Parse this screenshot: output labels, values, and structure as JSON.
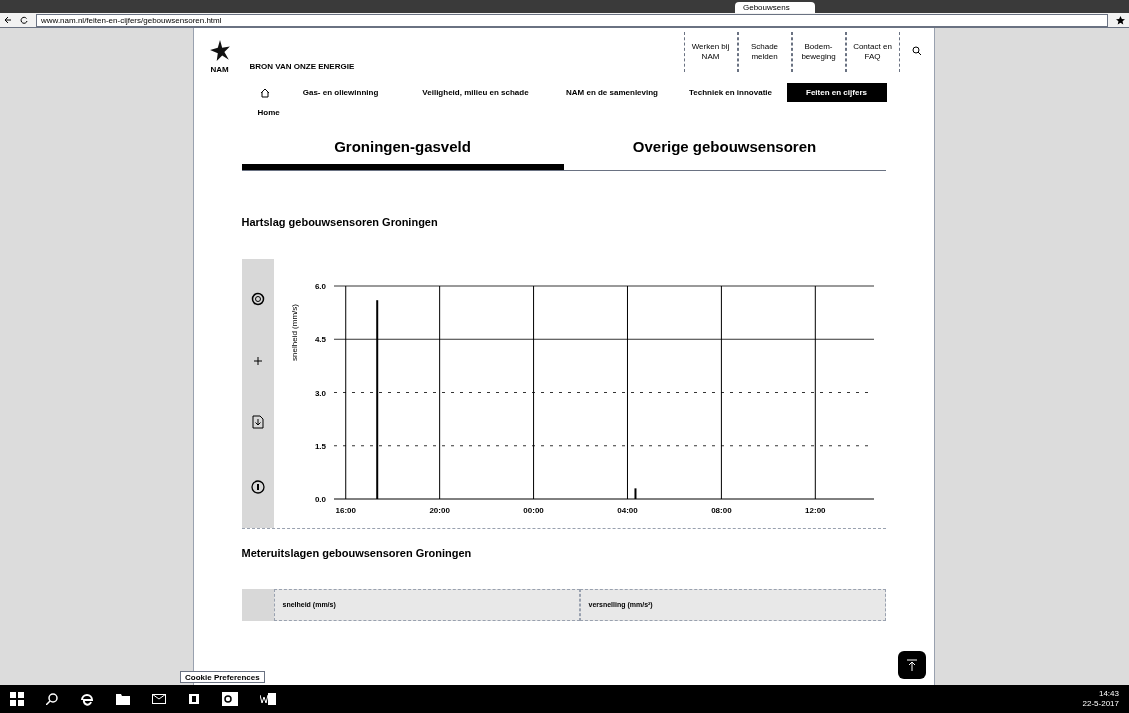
{
  "browser": {
    "tabs": [
      {
        "label": "Gebouwsens",
        "selected": true
      }
    ],
    "url": "www.nam.nl/feiten-en-cijfers/gebouwsensoren.html"
  },
  "header": {
    "logo": "NAM",
    "tagline": "BRON VAN ONZE ENERGIE",
    "utility_links": [
      "Werken bij NAM",
      "Schade melden",
      "Bodem-beweging",
      "Contact en FAQ"
    ],
    "nav": [
      {
        "label": "Gas- en oliewinning",
        "selected": false
      },
      {
        "label": "Veiligheid, milieu en schade",
        "selected": false
      },
      {
        "label": "NAM en de samenleving",
        "selected": false
      },
      {
        "label": "Techniek en innovatie",
        "selected": false
      },
      {
        "label": "Feiten en cijfers",
        "selected": true
      }
    ],
    "home": "Home"
  },
  "tabs": [
    {
      "label": "Groningen-gasveld",
      "selected": true
    },
    {
      "label": "Overige gebouwsensoren",
      "selected": false
    }
  ],
  "section_title": "Hartslag gebouwsensoren Groningen",
  "chart_data": {
    "type": "bar",
    "grid": true,
    "ylabel": "snelheid (mm/s)",
    "categories": [
      "16:00",
      null,
      null,
      null,
      "20:00",
      null,
      null,
      null,
      "00:00",
      null,
      null,
      null,
      "04:00",
      null,
      null,
      null,
      "08:00",
      null,
      null,
      null,
      "12:00",
      null,
      null
    ],
    "series": [
      {
        "color": "#000000",
        "values": [
          0,
          5.6,
          0,
          0,
          0,
          0,
          0,
          0,
          0,
          0,
          0,
          0,
          0.3,
          0,
          0,
          0,
          0,
          0,
          0,
          0,
          0,
          0,
          0
        ]
      }
    ],
    "ylim": [
      0,
      6
    ],
    "yticks": [
      {
        "value": 0,
        "label": "0.0"
      },
      {
        "value": 1.5,
        "label": "1.5"
      },
      {
        "value": 3,
        "label": "3.0"
      },
      {
        "value": 4.5,
        "label": "4.5"
      },
      {
        "value": 6,
        "label": "6.0"
      }
    ]
  },
  "section2_title": "Meteruitslagen gebouwsensoren Groningen",
  "table_columns": [
    "snelheid (mm/s)",
    "versnelling (mm/s²)"
  ],
  "cookie": "Cookie Preferences",
  "taskbar": {
    "time": "14:43",
    "date": "22-5-2017"
  }
}
